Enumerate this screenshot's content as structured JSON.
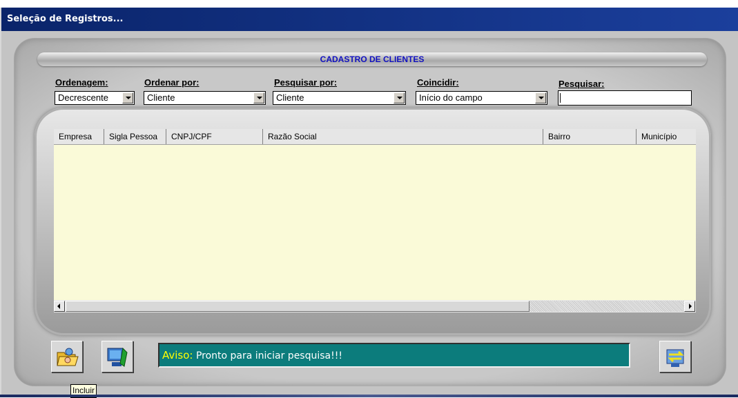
{
  "window": {
    "title": "Seleção de Registros..."
  },
  "banner": {
    "title": "CADASTRO DE CLIENTES"
  },
  "filters": {
    "ordenagem_label": "Ordenagem:",
    "ordenagem_value": "Decrescente",
    "ordenar_por_label": "Ordenar por:",
    "ordenar_por_value": "Cliente",
    "pesquisar_por_label": "Pesquisar por:",
    "pesquisar_por_value": "Cliente",
    "coincidir_label": "Coincidir:",
    "coincidir_value": "Início do campo",
    "pesquisar_label": "Pesquisar:",
    "pesquisar_value": ""
  },
  "grid": {
    "columns": [
      "Empresa",
      "Sigla Pessoa",
      "CNPJ/CPF",
      "Razão Social",
      "Bairro",
      "Município"
    ],
    "rows": []
  },
  "status": {
    "aviso_label": "Aviso:",
    "message": "Pronto para iniciar pesquisa!!!"
  },
  "tooltip": {
    "text": "Incluir"
  },
  "icons": {
    "include_button": "folder-open-icon",
    "computer_button": "computer-icon",
    "exit_button": "exit-swap-icon"
  }
}
